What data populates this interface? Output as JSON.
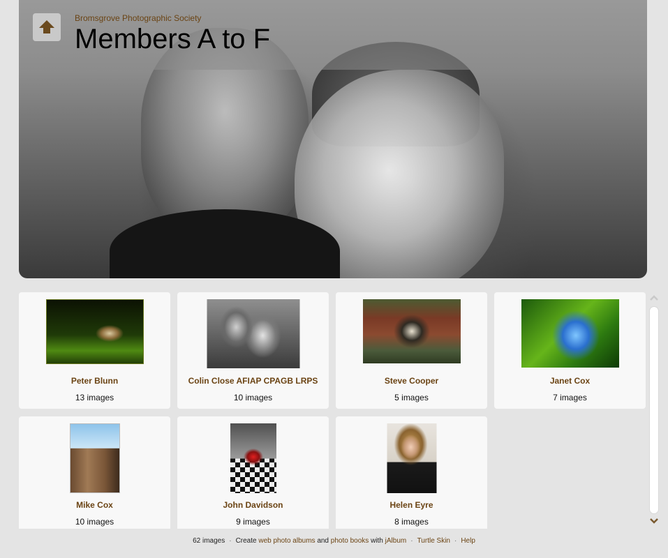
{
  "header": {
    "site_title": "Bromsgrove Photographic Society",
    "page_title": "Members A to F",
    "up_icon": "up-arrow-icon"
  },
  "albums": [
    {
      "name": "Peter Blunn",
      "count": "13 images"
    },
    {
      "name": "Colin Close AFIAP CPAGB LRPS",
      "count": "10 images"
    },
    {
      "name": "Steve Cooper",
      "count": "5 images"
    },
    {
      "name": "Janet Cox",
      "count": "7 images"
    },
    {
      "name": "Mike Cox",
      "count": "10 images"
    },
    {
      "name": "John Davidson",
      "count": "9 images"
    },
    {
      "name": "Helen Eyre",
      "count": "8 images"
    }
  ],
  "footer": {
    "image_count": "62 images",
    "create_text": "Create",
    "web_albums_link": "web photo albums",
    "and_text": "and",
    "photo_books_link": "photo books",
    "with_text": "with",
    "jalbum_link": "jAlbum",
    "skin_link": "Turtle Skin",
    "help_link": "Help"
  },
  "colors": {
    "link": "#6b4414",
    "card_bg": "#f8f8f8",
    "page_bg": "#e4e4e4"
  }
}
